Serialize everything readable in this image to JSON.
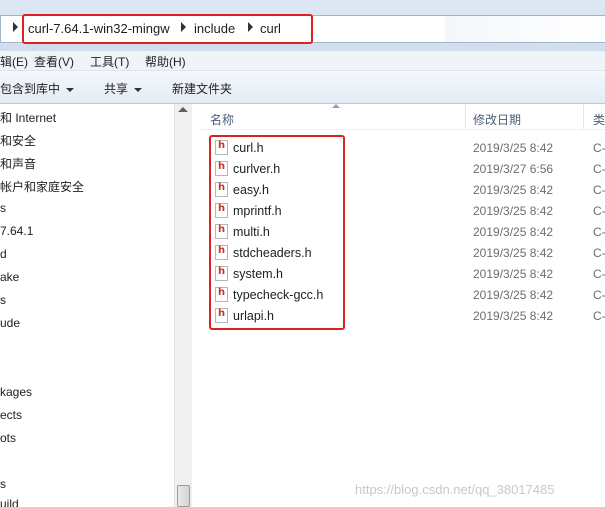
{
  "address": {
    "crumbs": [
      "curl-7.64.1-win32-mingw",
      "include",
      "curl"
    ]
  },
  "menu": {
    "items": [
      "辑(E)",
      "查看(V)",
      "工具(T)",
      "帮助(H)"
    ]
  },
  "toolbar": {
    "include_in_library": "包含到库中",
    "share": "共享",
    "new_folder": "新建文件夹"
  },
  "nav": {
    "items": [
      "和 Internet",
      "和安全",
      "和声音",
      "帐户和家庭安全",
      "s",
      "7.64.1",
      "d",
      "ake",
      "s",
      "ude",
      "kages",
      "ects",
      "ots",
      "s",
      "uild"
    ]
  },
  "columns": {
    "name": "名称",
    "date": "修改日期",
    "type": "类"
  },
  "files": [
    {
      "name": "curl.h",
      "date": "2019/3/25 8:42",
      "type": "C-"
    },
    {
      "name": "curlver.h",
      "date": "2019/3/27 6:56",
      "type": "C-"
    },
    {
      "name": "easy.h",
      "date": "2019/3/25 8:42",
      "type": "C-"
    },
    {
      "name": "mprintf.h",
      "date": "2019/3/25 8:42",
      "type": "C-"
    },
    {
      "name": "multi.h",
      "date": "2019/3/25 8:42",
      "type": "C-"
    },
    {
      "name": "stdcheaders.h",
      "date": "2019/3/25 8:42",
      "type": "C-"
    },
    {
      "name": "system.h",
      "date": "2019/3/25 8:42",
      "type": "C-"
    },
    {
      "name": "typecheck-gcc.h",
      "date": "2019/3/25 8:42",
      "type": "C-"
    },
    {
      "name": "urlapi.h",
      "date": "2019/3/25 8:42",
      "type": "C-"
    }
  ],
  "watermark": "https://blog.csdn.net/qq_38017485",
  "colors": {
    "highlight": "#e02020",
    "header_text": "#4c607a"
  }
}
